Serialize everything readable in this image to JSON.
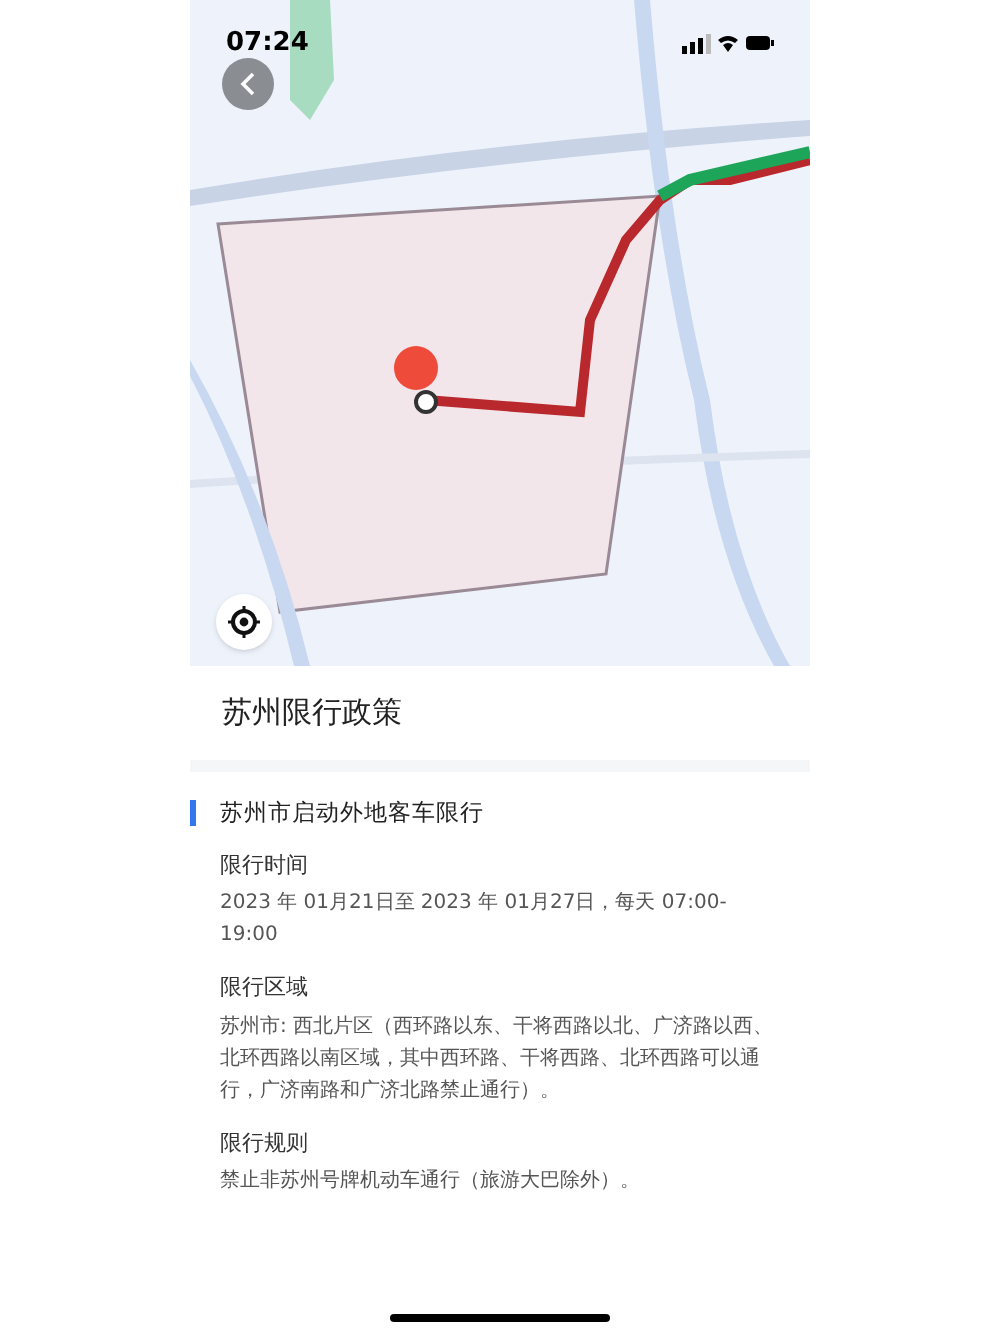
{
  "status_bar": {
    "time": "07:24"
  },
  "page": {
    "title": "苏州限行政策"
  },
  "notice": {
    "title": "苏州市启动外地客车限行",
    "sections": [
      {
        "label": "限行时间",
        "value": "2023 年 01月21日至 2023 年 01月27日，每天 07:00-19:00"
      },
      {
        "label": "限行区域",
        "value": "苏州市: 西北片区（西环路以东、干将西路以北、广济路以西、北环西路以南区域，其中西环路、干将西路、北环西路可以通行，广济南路和广济北路禁止通行）。"
      },
      {
        "label": "限行规则",
        "value": "禁止非苏州号牌机动车通行（旅游大巴除外）。"
      }
    ]
  }
}
